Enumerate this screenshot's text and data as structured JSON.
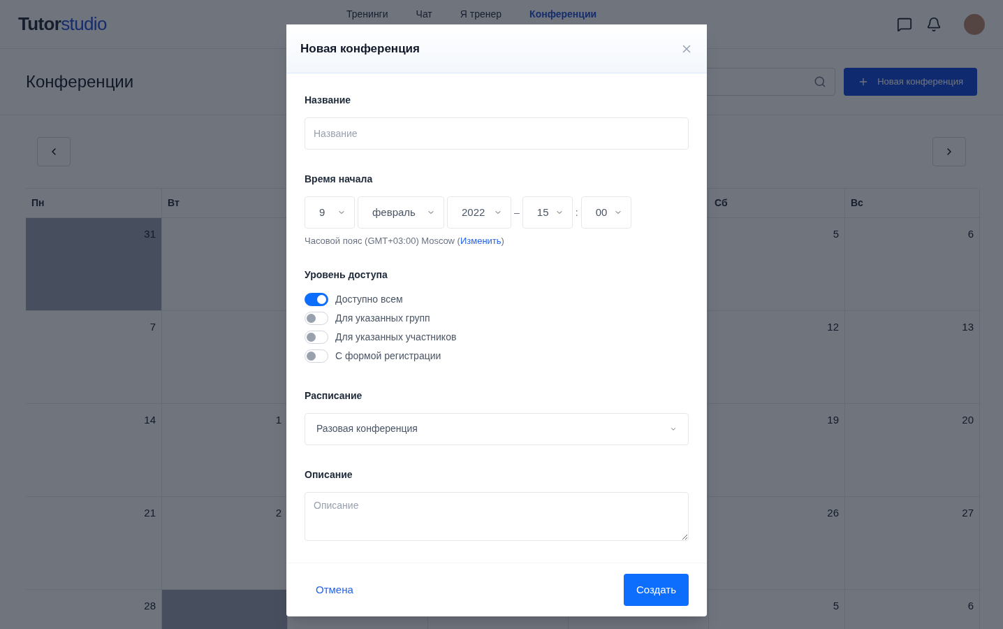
{
  "header": {
    "logo": {
      "strong": "Tutor",
      "light": "studio"
    },
    "nav": [
      {
        "label": "Тренинги",
        "selected": false
      },
      {
        "label": "Чат",
        "selected": false
      },
      {
        "label": "Я тренер",
        "selected": false
      },
      {
        "label": "Конференции",
        "selected": true
      }
    ]
  },
  "page": {
    "title": "Конференции",
    "new_button": "Новая конференция"
  },
  "calendar": {
    "weekdays": [
      "Пн",
      "Вт",
      "Сб",
      "Вс"
    ],
    "weeks": [
      [
        {
          "day": "31",
          "muted": true
        },
        {
          "muted": false
        },
        {
          "day": "5",
          "muted": false
        },
        {
          "day": "6",
          "muted": false
        }
      ],
      [
        {
          "day": "7",
          "muted": false
        },
        {
          "muted": false
        },
        {
          "day": "12",
          "muted": false
        },
        {
          "day": "13",
          "muted": false
        }
      ],
      [
        {
          "day": "14",
          "muted": false
        },
        {
          "day": "1",
          "muted": false
        },
        {
          "day": "19",
          "muted": false
        },
        {
          "day": "20",
          "muted": false
        }
      ],
      [
        {
          "day": "21",
          "muted": false
        },
        {
          "day": "2",
          "muted": false
        },
        {
          "day": "26",
          "muted": false
        },
        {
          "day": "27",
          "muted": false
        }
      ],
      [
        {
          "day": "28",
          "muted": false
        },
        {
          "muted": true
        },
        {
          "day": "5",
          "muted": false
        },
        {
          "day": "6",
          "muted": false
        }
      ]
    ]
  },
  "modal": {
    "title": "Новая конференция",
    "name": {
      "label": "Название",
      "placeholder": "Название"
    },
    "start": {
      "label": "Время начала",
      "day": "9",
      "month": "февраль",
      "year": "2022",
      "dash": "–",
      "hour": "15",
      "colon": ":",
      "minute": "00",
      "timezone": "Часовой пояс (GMT+03:00) Moscow (",
      "timezone_link": "Изменить",
      "timezone_end": ")"
    },
    "access": {
      "label": "Уровень доступа",
      "options": [
        {
          "label": "Доступно всем",
          "on": true
        },
        {
          "label": "Для указанных групп",
          "on": false
        },
        {
          "label": "Для указанных участников",
          "on": false
        },
        {
          "label": "С формой регистрации",
          "on": false
        }
      ]
    },
    "schedule": {
      "label": "Расписание",
      "value": "Разовая конференция"
    },
    "description": {
      "label": "Описание",
      "placeholder": "Описание"
    },
    "cancel": "Отмена",
    "submit": "Создать"
  }
}
